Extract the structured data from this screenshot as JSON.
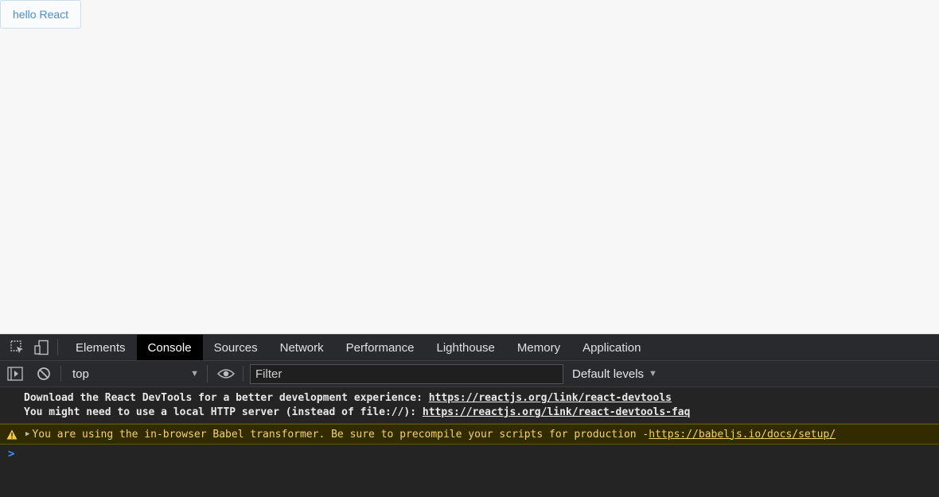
{
  "page": {
    "button_label": "hello React"
  },
  "devtools": {
    "tabs": [
      "Elements",
      "Console",
      "Sources",
      "Network",
      "Performance",
      "Lighthouse",
      "Memory",
      "Application"
    ],
    "active_tab": "Console",
    "toolbar": {
      "context": "top",
      "filter_placeholder": "Filter",
      "levels": "Default levels"
    },
    "messages": {
      "line1_text": "Download the React DevTools for a better development experience: ",
      "line1_link": "https://reactjs.org/link/react-devtools",
      "line2_text": "You might need to use a local HTTP server (instead of file://): ",
      "line2_link": "https://reactjs.org/link/react-devtools-faq",
      "warning_text": "You are using the in-browser Babel transformer. Be sure to precompile your scripts for production - ",
      "warning_link": "https://babeljs.io/docs/setup/"
    },
    "prompt": ">"
  },
  "colors": {
    "accent": "#4a8cff",
    "warning_bg": "#332b00",
    "warning_text": "#f2d36b"
  },
  "icons": [
    "inspect-element-icon",
    "device-toolbar-icon",
    "sidebar-toggle-icon",
    "clear-console-icon",
    "eye-icon",
    "warning-icon"
  ]
}
